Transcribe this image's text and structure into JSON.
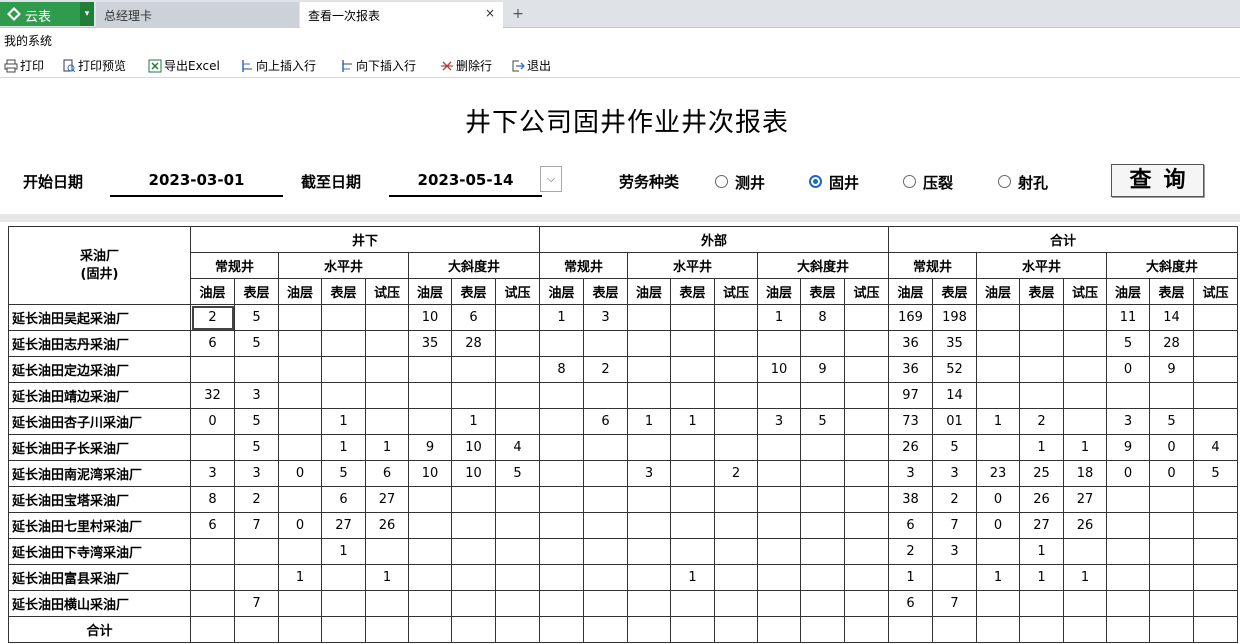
{
  "app": {
    "name": "云表",
    "dropdown_arrow": "▾",
    "brand_color": "#2e9b4d",
    "logo_icon": "diamond-logo-icon"
  },
  "tabs": [
    {
      "label": "总经理卡",
      "active": false
    },
    {
      "label": "查看一次报表",
      "active": true,
      "close": "×"
    }
  ],
  "tab_add": "+",
  "system_label": "我的系统",
  "toolbar": [
    {
      "label": "打印",
      "icon": "printer-icon"
    },
    {
      "label": "打印预览",
      "icon": "print-preview-icon"
    },
    {
      "label": "导出Excel",
      "icon": "excel-icon"
    },
    {
      "label": "向上插入行",
      "icon": "insert-row-above-icon"
    },
    {
      "label": "向下插入行",
      "icon": "insert-row-below-icon"
    },
    {
      "label": "删除行",
      "icon": "delete-row-icon"
    },
    {
      "label": "退出",
      "icon": "exit-icon"
    }
  ],
  "report": {
    "title": "井下公司固井作业井次报表",
    "start_label": "开始日期",
    "start_date": "2023-03-01",
    "end_label": "截至日期",
    "end_date": "2023-05-14",
    "date_dropdown": "⌵",
    "type_label": "劳务种类",
    "types": [
      {
        "label": "测井",
        "selected": false
      },
      {
        "label": "固井",
        "selected": true
      },
      {
        "label": "压裂",
        "selected": false
      },
      {
        "label": "射孔",
        "selected": false
      }
    ],
    "query_button": "查询"
  },
  "grid": {
    "corner": [
      "采油厂",
      "(固井)"
    ],
    "groups": [
      "井下",
      "外部",
      "合计"
    ],
    "subgroups": [
      "常规井",
      "水平井",
      "大斜度井"
    ],
    "leaf_headers": [
      "油层",
      "表层",
      "油层",
      "表层",
      "试压",
      "油层",
      "表层",
      "试压"
    ],
    "rows": [
      {
        "name": "延长油田吴起采油厂",
        "cells": [
          "2",
          "5",
          "",
          "",
          "",
          "10",
          "6",
          "",
          "1",
          "3",
          "",
          "",
          "",
          "1",
          "8",
          "",
          "169",
          "198",
          "",
          "",
          "",
          "11",
          "14",
          ""
        ]
      },
      {
        "name": "延长油田志丹采油厂",
        "cells": [
          "6",
          "5",
          "",
          "",
          "",
          "35",
          "28",
          "",
          "",
          "",
          "",
          "",
          "",
          "",
          "",
          "",
          "36",
          "35",
          "",
          "",
          "",
          "5",
          "28",
          ""
        ]
      },
      {
        "name": "延长油田定边采油厂",
        "cells": [
          "",
          "",
          "",
          "",
          "",
          "",
          "",
          "",
          "8",
          "2",
          "",
          "",
          "",
          "10",
          "9",
          "",
          "36",
          "52",
          "",
          "",
          "",
          "0",
          "9",
          ""
        ]
      },
      {
        "name": "延长油田靖边采油厂",
        "cells": [
          "32",
          "3",
          "",
          "",
          "",
          "",
          "",
          "",
          "",
          "",
          "",
          "",
          "",
          "",
          "",
          "",
          "97",
          "14",
          "",
          "",
          "",
          "",
          "",
          ""
        ]
      },
      {
        "name": "延长油田杏子川采油厂",
        "cells": [
          "0",
          "5",
          "",
          "1",
          "",
          "",
          "1",
          "",
          "",
          "6",
          "1",
          "1",
          "",
          "3",
          "5",
          "",
          "73",
          "01",
          "1",
          "2",
          "",
          "3",
          "5",
          ""
        ]
      },
      {
        "name": "延长油田子长采油厂",
        "cells": [
          "",
          "5",
          "",
          "1",
          "1",
          "9",
          "10",
          "4",
          "",
          "",
          "",
          "",
          "",
          "",
          "",
          "",
          "26",
          "5",
          "",
          "1",
          "1",
          "9",
          "0",
          "4"
        ]
      },
      {
        "name": "延长油田南泥湾采油厂",
        "cells": [
          "3",
          "3",
          "0",
          "5",
          "6",
          "10",
          "10",
          "5",
          "",
          "",
          "3",
          "",
          "2",
          "",
          "",
          "",
          "3",
          "3",
          "23",
          "25",
          "18",
          "0",
          "0",
          "5"
        ]
      },
      {
        "name": "延长油田宝塔采油厂",
        "cells": [
          "8",
          "2",
          "",
          "6",
          "27",
          "",
          "",
          "",
          "",
          "",
          "",
          "",
          "",
          "",
          "",
          "",
          "38",
          "2",
          "0",
          "26",
          "27",
          "",
          "",
          ""
        ]
      },
      {
        "name": "延长油田七里村采油厂",
        "cells": [
          "6",
          "7",
          "0",
          "27",
          "26",
          "",
          "",
          "",
          "",
          "",
          "",
          "",
          "",
          "",
          "",
          "",
          "6",
          "7",
          "0",
          "27",
          "26",
          "",
          "",
          ""
        ]
      },
      {
        "name": "延长油田下寺湾采油厂",
        "cells": [
          "",
          "",
          "",
          "1",
          "",
          "",
          "",
          "",
          "",
          "",
          "",
          "",
          "",
          "",
          "",
          "",
          "2",
          "3",
          "",
          "1",
          "",
          "",
          "",
          ""
        ]
      },
      {
        "name": "延长油田富县采油厂",
        "cells": [
          "",
          "",
          "1",
          "",
          "1",
          "",
          "",
          "",
          "",
          "",
          "",
          "1",
          "",
          "",
          "",
          "",
          "1",
          "",
          "1",
          "1",
          "1",
          "",
          "",
          ""
        ]
      },
      {
        "name": "延长油田横山采油厂",
        "cells": [
          "",
          "7",
          "",
          "",
          "",
          "",
          "",
          "",
          "",
          "",
          "",
          "",
          "",
          "",
          "",
          "",
          "6",
          "7",
          "",
          "",
          "",
          "",
          "",
          ""
        ]
      }
    ],
    "total_label": "合计"
  }
}
